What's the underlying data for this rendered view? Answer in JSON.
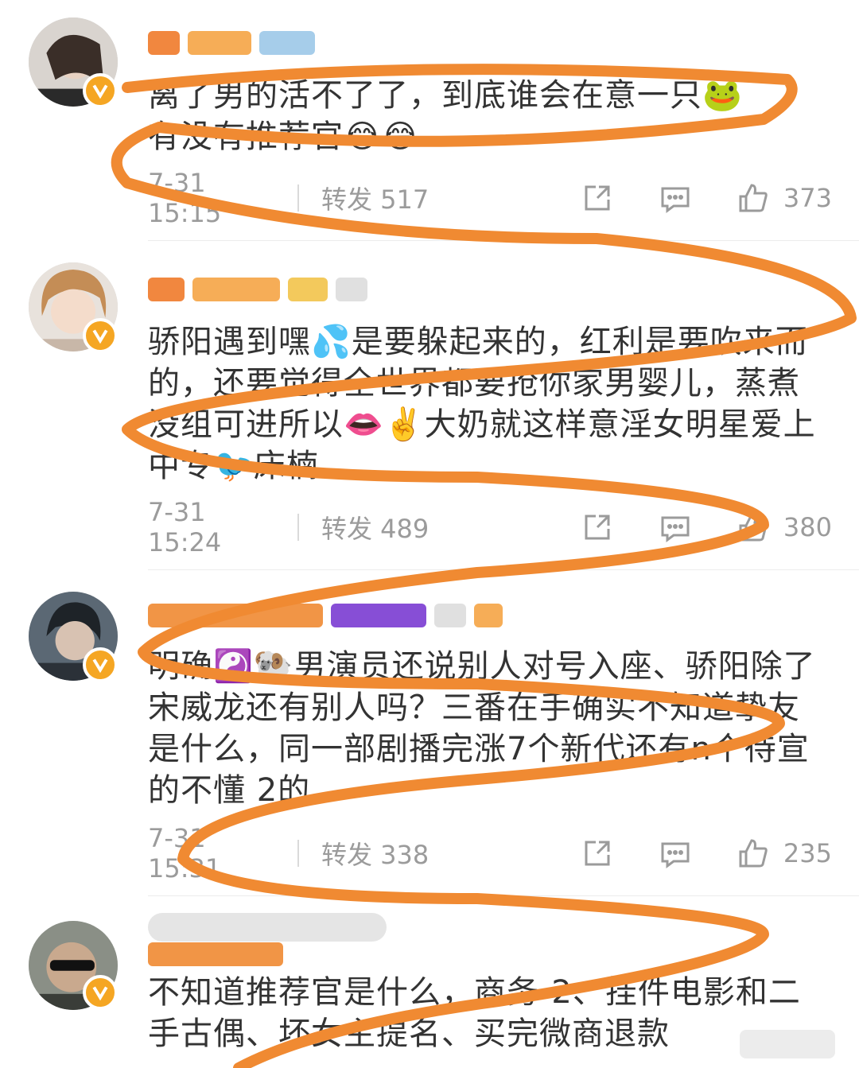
{
  "posts": [
    {
      "content": "离了男的活不了了，到底谁会在意一只🐸\n有没有推荐官😂😂",
      "time": "7-31 15:15",
      "repost": "转发 517",
      "likes": "373"
    },
    {
      "content": "骄阳遇到嘿💦是要躲起来的，红利是要吹来而的，还要觉得全世界都要抢你家男婴儿，蒸煮没组可进所以👄✌️大奶就这样意淫女明星爱上中专🐦床楠",
      "time": "7-31 15:24",
      "repost": "转发 489",
      "likes": "380"
    },
    {
      "content": "明确☯️🐏男演员还说别人对号入座、骄阳除了宋威龙还有别人吗？三番在手确实不知道挚友是什么，同一部剧播完涨7个新代还有n个待宣的不懂 2的",
      "time": "7-31 15:31",
      "repost": "转发 338",
      "likes": "235"
    },
    {
      "content": "不知道推荐官是什么，商务-2、挂件电影和二手古偶、坏女主提名、买完微商退款"
    }
  ],
  "colors": {
    "scribble": "#f08a32",
    "badge": "#f5a623",
    "meta": "#9b9b9b",
    "text": "#333333"
  },
  "icons": [
    "share-icon",
    "comment-icon",
    "like-icon",
    "verified-badge-icon"
  ]
}
